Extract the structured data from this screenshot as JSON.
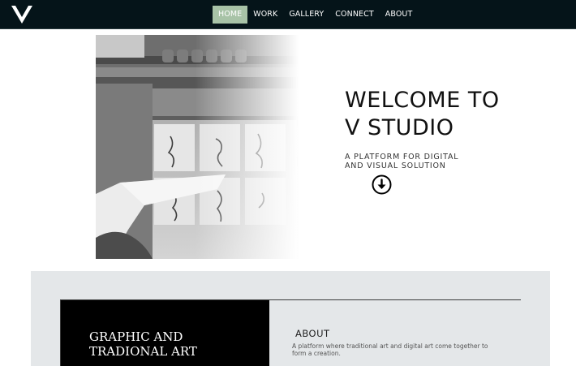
{
  "nav": {
    "logo_letter": "V",
    "items": [
      {
        "label": "HOME",
        "active": true
      },
      {
        "label": "WORK",
        "active": false
      },
      {
        "label": "GALLERY",
        "active": false
      },
      {
        "label": "CONNECT",
        "active": false
      },
      {
        "label": "ABOUT",
        "active": false
      }
    ],
    "active_color": "#a8c3a7",
    "bar_color": "#051419"
  },
  "hero": {
    "title_line1": "WELCOME TO",
    "title_line2": "V STUDIO",
    "subtitle_line1": "A PLATFORM FOR DIGITAL",
    "subtitle_line2": "AND VISUAL SOLUTION",
    "scroll_icon": "arrow-down-circle-icon",
    "image": "studio-sketches-photo"
  },
  "section": {
    "card_title_line1": "GRAPHIC AND",
    "card_title_line2": "TRADIONAL ART",
    "about_heading": "ABOUT",
    "about_text": "A platform where traditional art and digital art come together to form a creation."
  }
}
